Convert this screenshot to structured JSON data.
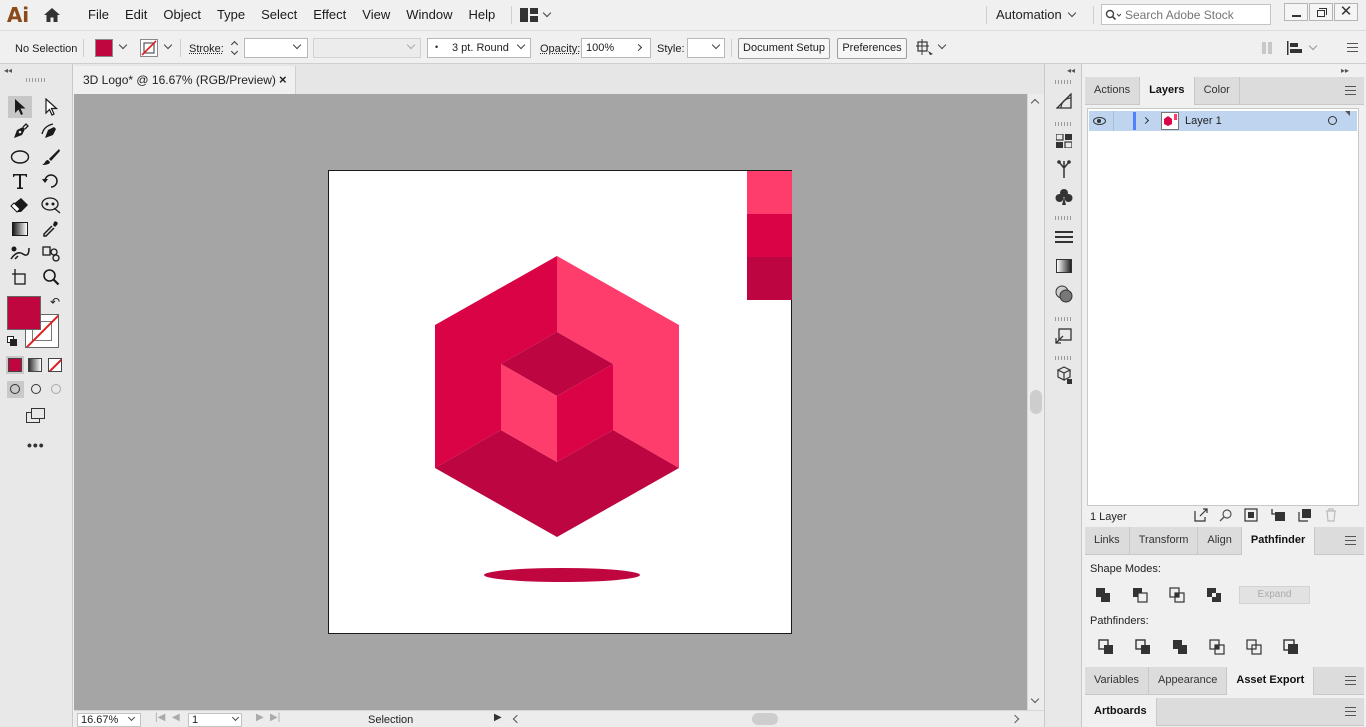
{
  "app": {
    "logo": "Ai"
  },
  "menu": [
    "File",
    "Edit",
    "Object",
    "Type",
    "Select",
    "Effect",
    "View",
    "Window",
    "Help"
  ],
  "workspace": {
    "label": "Automation"
  },
  "search": {
    "placeholder": "Search Adobe Stock"
  },
  "control": {
    "selection": "No Selection",
    "stroke_label": "Stroke:",
    "brush_value": "3 pt. Round",
    "opacity_label": "Opacity:",
    "opacity_value": "100%",
    "style_label": "Style:",
    "document_setup": "Document Setup",
    "preferences": "Preferences"
  },
  "document": {
    "tab_title": "3D Logo* @ 16.67% (RGB/Preview)",
    "close": "×"
  },
  "colors": {
    "fill": "#c0063f",
    "hex_dark": "#bc0541",
    "hex_mid": "#da0345",
    "hex_light": "#ff3d6c",
    "swatch_top": "#ff3d6c",
    "swatch_mid": "#da0345",
    "swatch_bottom": "#bc0541",
    "shadow": "#c0063f"
  },
  "panels": {
    "top_tabs": [
      "Actions",
      "Layers",
      "Color"
    ],
    "layers": [
      {
        "name": "Layer 1"
      }
    ],
    "layer_count": "1 Layer",
    "mid_tabs": [
      "Links",
      "Transform",
      "Align",
      "Pathfinder"
    ],
    "shape_modes_label": "Shape Modes:",
    "expand_label": "Expand",
    "pathfinders_label": "Pathfinders:",
    "bottom_tabs": [
      "Variables",
      "Appearance",
      "Asset Export"
    ],
    "artboards_tab": "Artboards"
  },
  "status": {
    "zoom": "16.67%",
    "artboard_number": "1",
    "tool": "Selection"
  }
}
